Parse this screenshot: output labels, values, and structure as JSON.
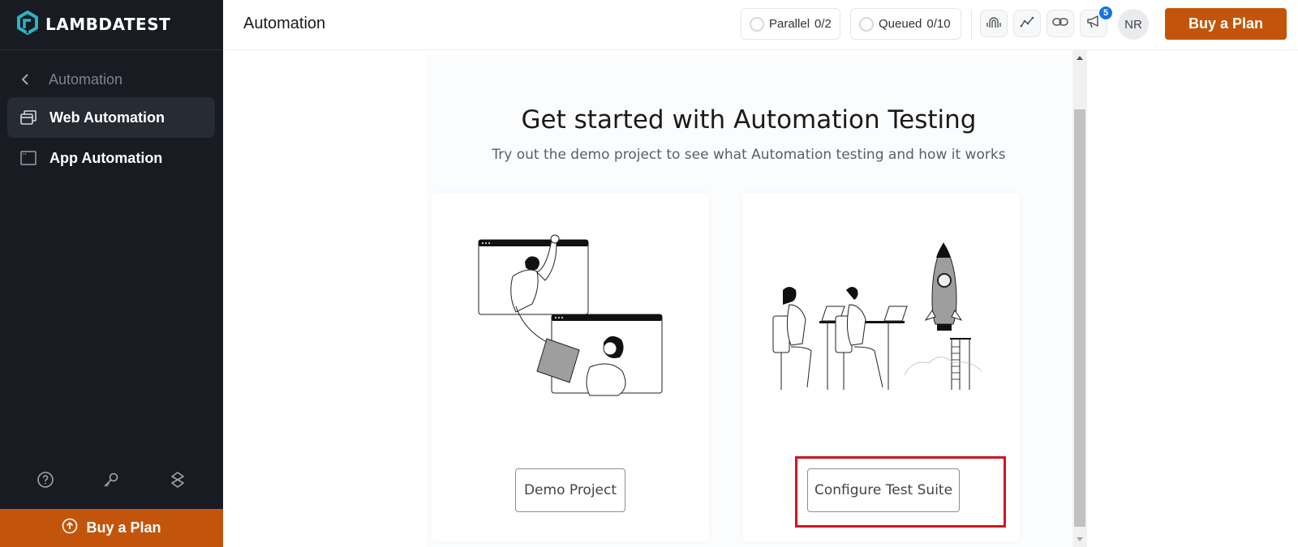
{
  "brand": {
    "name": "LAMBDATEST",
    "accent": "#c2550b",
    "logo_color": "#2bb3c0"
  },
  "sidebar": {
    "back_label": "Automation",
    "items": [
      {
        "label": "Web Automation",
        "icon": "browser-windows-icon",
        "active": true
      },
      {
        "label": "App Automation",
        "icon": "app-window-icon",
        "active": false
      }
    ],
    "bottom_icons": [
      "help-icon",
      "key-icon",
      "integration-icon"
    ],
    "buy_label": "Buy a Plan"
  },
  "header": {
    "title": "Automation",
    "parallel": {
      "label": "Parallel",
      "value": "0/2"
    },
    "queued": {
      "label": "Queued",
      "value": "0/10"
    },
    "icons": [
      "fingerprint-icon",
      "analytics-icon",
      "link-icon",
      "megaphone-icon"
    ],
    "notification_count": "5",
    "avatar_initials": "NR",
    "buy_label": "Buy a Plan"
  },
  "main": {
    "title": "Get started with Automation Testing",
    "subtitle": "Try out the demo project to see what Automation testing and how it works",
    "cards": [
      {
        "illustration": "file-handover-illustration",
        "button_label": "Demo Project"
      },
      {
        "illustration": "rocket-launch-team-illustration",
        "button_label": "Configure Test Suite",
        "highlighted": true
      }
    ]
  }
}
